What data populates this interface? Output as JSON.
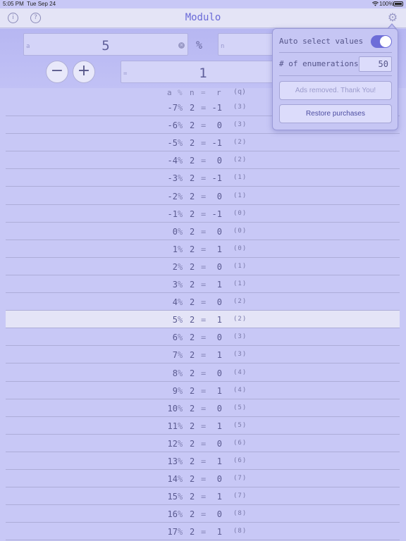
{
  "status": {
    "time": "5:05 PM",
    "date": "Tue Sep 24",
    "battery": "100%"
  },
  "nav": {
    "title": "Modulo",
    "info_glyph": "i",
    "help_glyph": "?",
    "gear_glyph": "⚙"
  },
  "inputs": {
    "a_placeholder": "a",
    "a_value": "5",
    "operator": "%",
    "n_placeholder": "n",
    "result_prefix": "=",
    "result_value": "1",
    "minus_label": "−",
    "plus_label": "+",
    "clear_glyph": "×"
  },
  "columns": {
    "a": "a",
    "op": "%",
    "n": "n",
    "eq": "=",
    "r": "r",
    "q": "(q)"
  },
  "rows": [
    {
      "a": "-7",
      "n": "2",
      "r": "-1",
      "q": "(3)"
    },
    {
      "a": "-6",
      "n": "2",
      "r": "0",
      "q": "(3)"
    },
    {
      "a": "-5",
      "n": "2",
      "r": "-1",
      "q": "(2)"
    },
    {
      "a": "-4",
      "n": "2",
      "r": "0",
      "q": "(2)"
    },
    {
      "a": "-3",
      "n": "2",
      "r": "-1",
      "q": "(1)"
    },
    {
      "a": "-2",
      "n": "2",
      "r": "0",
      "q": "(1)"
    },
    {
      "a": "-1",
      "n": "2",
      "r": "-1",
      "q": "(0)"
    },
    {
      "a": "0",
      "n": "2",
      "r": "0",
      "q": "(0)"
    },
    {
      "a": "1",
      "n": "2",
      "r": "1",
      "q": "(0)"
    },
    {
      "a": "2",
      "n": "2",
      "r": "0",
      "q": "(1)"
    },
    {
      "a": "3",
      "n": "2",
      "r": "1",
      "q": "(1)"
    },
    {
      "a": "4",
      "n": "2",
      "r": "0",
      "q": "(2)"
    },
    {
      "a": "5",
      "n": "2",
      "r": "1",
      "q": "(2)",
      "highlight": true
    },
    {
      "a": "6",
      "n": "2",
      "r": "0",
      "q": "(3)"
    },
    {
      "a": "7",
      "n": "2",
      "r": "1",
      "q": "(3)"
    },
    {
      "a": "8",
      "n": "2",
      "r": "0",
      "q": "(4)"
    },
    {
      "a": "9",
      "n": "2",
      "r": "1",
      "q": "(4)"
    },
    {
      "a": "10",
      "n": "2",
      "r": "0",
      "q": "(5)"
    },
    {
      "a": "11",
      "n": "2",
      "r": "1",
      "q": "(5)"
    },
    {
      "a": "12",
      "n": "2",
      "r": "0",
      "q": "(6)"
    },
    {
      "a": "13",
      "n": "2",
      "r": "1",
      "q": "(6)"
    },
    {
      "a": "14",
      "n": "2",
      "r": "0",
      "q": "(7)"
    },
    {
      "a": "15",
      "n": "2",
      "r": "1",
      "q": "(7)"
    },
    {
      "a": "16",
      "n": "2",
      "r": "0",
      "q": "(8)"
    },
    {
      "a": "17",
      "n": "2",
      "r": "1",
      "q": "(8)"
    }
  ],
  "popover": {
    "auto_select_label": "Auto select values",
    "auto_select_on": true,
    "enumerations_label": "# of enumerations",
    "enumerations_value": "50",
    "ads_button": "Ads removed. Thank You!",
    "restore_button": "Restore purchases"
  },
  "colors": {
    "accent": "#6d6dd8",
    "background": "#c8c8f6",
    "highlight_row": "#e4e4f7"
  }
}
